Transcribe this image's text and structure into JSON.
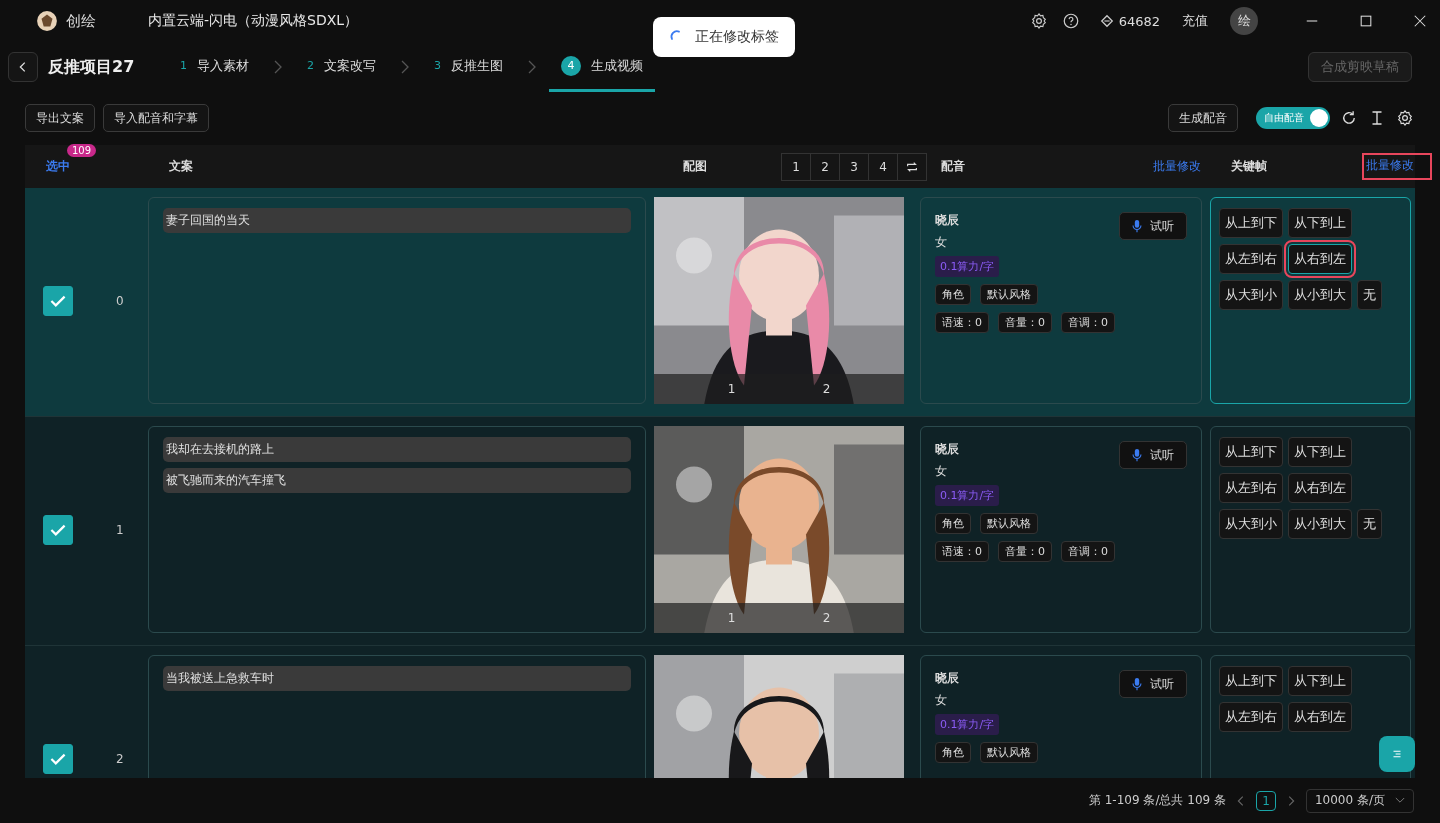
{
  "app": {
    "name": "创绘",
    "model": "内置云端-闪电（动漫风格SDXL）"
  },
  "toast": {
    "text": "正在修改标签"
  },
  "header_actions": {
    "credits": "64682",
    "recharge": "充值",
    "avatar": "绘"
  },
  "project": {
    "title": "反推项目27",
    "steps": [
      {
        "number": "1",
        "label": "导入素材",
        "selected": false
      },
      {
        "number": "2",
        "label": "文案改写",
        "selected": false
      },
      {
        "number": "3",
        "label": "反推生图",
        "selected": false
      },
      {
        "number": "4",
        "label": "生成视频",
        "selected": true
      }
    ],
    "compose_button": {
      "label": "合成剪映草稿",
      "disabled": true
    }
  },
  "toolbar": {
    "left_buttons": [
      "导出文案",
      "导入配音和字幕"
    ],
    "generate_button": "生成配音",
    "free_dub": {
      "label": "自由配音",
      "on": true
    }
  },
  "table": {
    "columns": {
      "select": "选中",
      "selected_count": "109",
      "text": "文案",
      "image": "配图",
      "image_pages": [
        "1",
        "2",
        "3",
        "4"
      ],
      "voice": "配音",
      "voice_batch": "批量修改",
      "keyframe": "关键帧",
      "keyframe_batch": {
        "label": "批量修改",
        "highlighted": true
      }
    },
    "rows": [
      {
        "index": "0",
        "checked": true,
        "active": true,
        "lines": [
          "妻子回国的当天"
        ],
        "image": {
          "kind": "picture",
          "marks": [
            "1",
            "2"
          ]
        },
        "voice": {
          "name": "晓辰",
          "gender": "女",
          "price": "0.1算力/字",
          "tags": [
            "角色",
            "默认风格"
          ],
          "params": [
            "语速：0",
            "音量：0",
            "音调：0"
          ],
          "preview": "试听"
        },
        "keyframes": [
          {
            "label": "从上到下",
            "selected": false,
            "highlighted": false
          },
          {
            "label": "从下到上",
            "selected": false,
            "highlighted": false
          },
          {
            "label": "从左到右",
            "selected": false,
            "highlighted": false
          },
          {
            "label": "从右到左",
            "selected": true,
            "highlighted": true
          },
          {
            "label": "从大到小",
            "selected": false,
            "highlighted": false
          },
          {
            "label": "从小到大",
            "selected": false,
            "highlighted": false
          },
          {
            "label": "无",
            "selected": false,
            "highlighted": false
          }
        ]
      },
      {
        "index": "1",
        "checked": true,
        "active": false,
        "lines": [
          "我却在去接机的路上",
          "被飞驰而来的汽车撞飞"
        ],
        "image": {
          "kind": "picture",
          "marks": [
            "1",
            "2"
          ]
        },
        "voice": {
          "name": "晓辰",
          "gender": "女",
          "price": "0.1算力/字",
          "tags": [
            "角色",
            "默认风格"
          ],
          "params": [
            "语速：0",
            "音量：0",
            "音调：0"
          ],
          "preview": "试听"
        },
        "keyframes": [
          {
            "label": "从上到下",
            "selected": false,
            "highlighted": false
          },
          {
            "label": "从下到上",
            "selected": false,
            "highlighted": false
          },
          {
            "label": "从左到右",
            "selected": false,
            "highlighted": false
          },
          {
            "label": "从右到左",
            "selected": false,
            "highlighted": false
          },
          {
            "label": "从大到小",
            "selected": false,
            "highlighted": false
          },
          {
            "label": "从小到大",
            "selected": false,
            "highlighted": false
          },
          {
            "label": "无",
            "selected": false,
            "highlighted": false
          }
        ]
      },
      {
        "index": "2",
        "checked": true,
        "active": false,
        "lines": [
          "当我被送上急救车时"
        ],
        "image": {
          "kind": "picture"
        },
        "voice": {
          "name": "晓辰",
          "gender": "女",
          "price": "0.1算力/字",
          "tags": [
            "角色",
            "默认风格"
          ],
          "preview": "试听"
        },
        "keyframes": [
          {
            "label": "从上到下",
            "selected": false,
            "highlighted": false
          },
          {
            "label": "从下到上",
            "selected": false,
            "highlighted": false
          },
          {
            "label": "从左到右",
            "selected": false,
            "highlighted": false
          },
          {
            "label": "从右到左",
            "selected": false,
            "highlighted": false
          }
        ]
      }
    ]
  },
  "pagination": {
    "summary": "第 1-109 条/总共 109 条",
    "pages": [
      {
        "label": "1",
        "selected": true
      }
    ],
    "page_size": "10000 条/页"
  }
}
